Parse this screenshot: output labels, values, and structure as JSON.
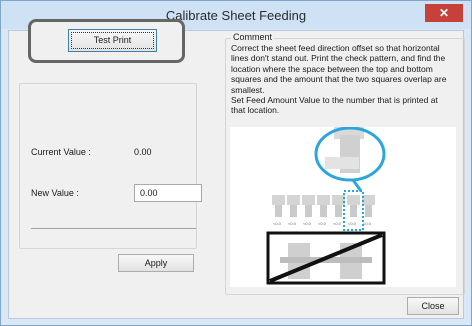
{
  "window": {
    "title": "Calibrate Sheet Feeding",
    "close_glyph": "✕"
  },
  "test_print": {
    "label": "Test Print"
  },
  "current_value": {
    "label": "Current Value :",
    "value": "0.00"
  },
  "new_value": {
    "label": "New Value :",
    "value": "0.00"
  },
  "apply": {
    "label": "Apply"
  },
  "comment": {
    "legend": "Comment",
    "lines": [
      "Correct the sheet feed direction offset so that horizontal",
      "lines don't stand out. Print the check pattern, and find the",
      "location where the space between the top and bottom",
      "squares and the amount that the two squares overlap are",
      "smallest.",
      "Set Feed Amount Value to the number that is printed at",
      "that location."
    ]
  },
  "illustration": {
    "tick_labels": [
      "<0.0",
      "<0.0",
      "<0.0",
      "<0.0",
      "<0.0",
      "<0.0",
      "<0.0"
    ]
  },
  "footer": {
    "close_label": "Close"
  },
  "colors": {
    "accent": "#3c7fb1",
    "callout": "#2aa6dc",
    "title_bar": "#cfe2f5",
    "close_red": "#c7413a"
  }
}
